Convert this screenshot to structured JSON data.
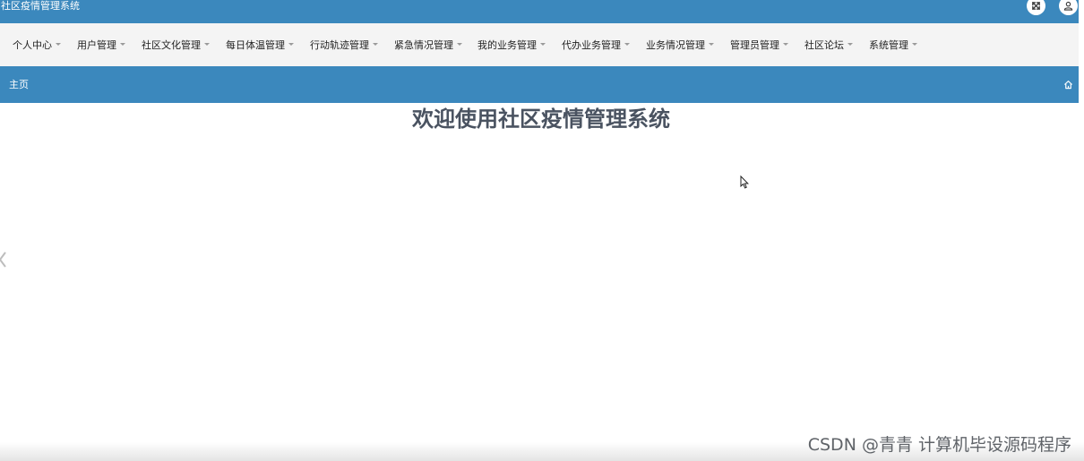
{
  "header": {
    "app_title": "社区疫情管理系统",
    "icons": [
      "fullscreen-icon",
      "user-icon"
    ]
  },
  "nav": {
    "items": [
      {
        "label": "个人中心"
      },
      {
        "label": "用户管理"
      },
      {
        "label": "社区文化管理"
      },
      {
        "label": "每日体温管理"
      },
      {
        "label": "行动轨迹管理"
      },
      {
        "label": "紧急情况管理"
      },
      {
        "label": "我的业务管理"
      },
      {
        "label": "代办业务管理"
      },
      {
        "label": "业务情况管理"
      },
      {
        "label": "管理员管理"
      },
      {
        "label": "社区论坛"
      },
      {
        "label": "系统管理"
      }
    ]
  },
  "breadcrumb": {
    "home_label": "主页",
    "icon": "home-icon"
  },
  "main": {
    "welcome_text": "欢迎使用社区疫情管理系统"
  },
  "watermark": {
    "text": "CSDN @青青  计算机毕设源码程序"
  },
  "colors": {
    "primary": "#3b88bd",
    "nav_background": "#f4f4f4",
    "title_text": "#4a5361"
  }
}
